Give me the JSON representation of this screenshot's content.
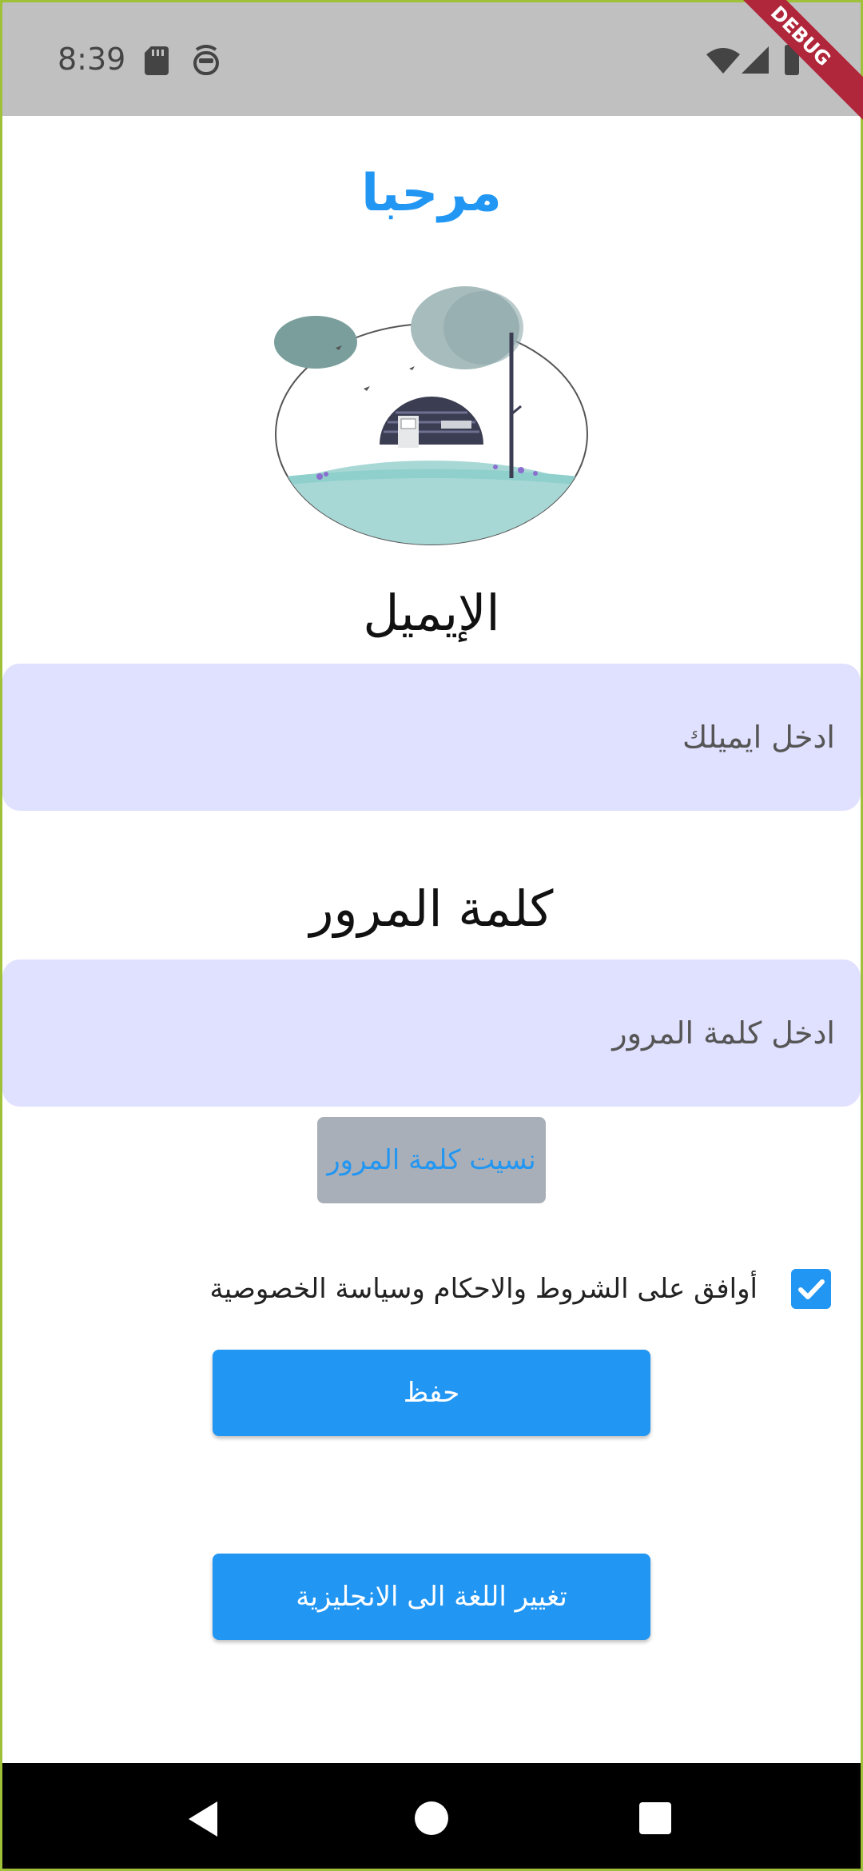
{
  "status_bar": {
    "time": "8:39",
    "debug_label": "DEBUG",
    "icons": [
      "sd-card-icon",
      "face-icon",
      "wifi-icon",
      "signal-icon",
      "battery-icon"
    ]
  },
  "header": {
    "title": "مرحبا"
  },
  "email": {
    "label": "الإيميل",
    "placeholder": "ادخل ايميلك"
  },
  "password": {
    "label": "كلمة المرور",
    "placeholder": "ادخل كلمة المرور"
  },
  "forgot_password": {
    "label": "نسيت كلمة المرور"
  },
  "terms": {
    "label": "أوافق على الشروط والاحكام وسياسة الخصوصية",
    "checked": true
  },
  "save_button": {
    "label": "حفظ"
  },
  "language_button": {
    "label": "تغيير اللغة الى الانجليزية"
  },
  "navigation": {
    "icons": [
      "back-icon",
      "home-icon",
      "recents-icon"
    ]
  },
  "colors": {
    "accent": "#2196f3",
    "field_background": "#e0e0ff",
    "forgot_button_background": "#a9afb8",
    "status_bar": "#c0c0c0",
    "debug_banner": "#b0263a"
  }
}
